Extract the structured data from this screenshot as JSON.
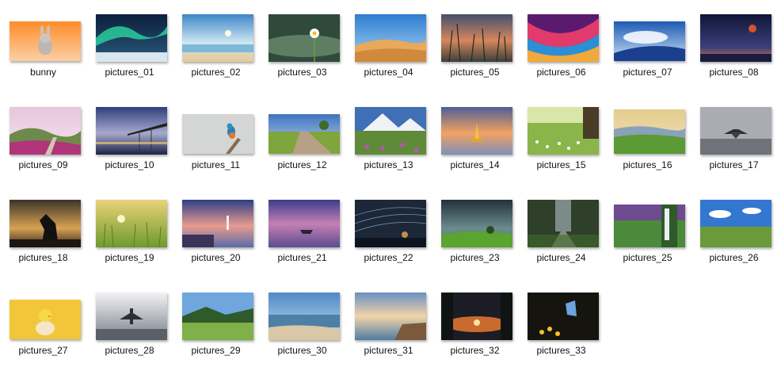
{
  "files": [
    {
      "name": "bunny",
      "icon": "bunny-image"
    },
    {
      "name": "pictures_01",
      "icon": "aurora-image"
    },
    {
      "name": "pictures_02",
      "icon": "seascape-image"
    },
    {
      "name": "pictures_03",
      "icon": "daisy-image"
    },
    {
      "name": "pictures_04",
      "icon": "desert-image"
    },
    {
      "name": "pictures_05",
      "icon": "grass-sunset-image"
    },
    {
      "name": "pictures_06",
      "icon": "abstract-waves-image"
    },
    {
      "name": "pictures_07",
      "icon": "sky-wave-image"
    },
    {
      "name": "pictures_08",
      "icon": "balloon-night-image"
    },
    {
      "name": "pictures_09",
      "icon": "flower-hills-image"
    },
    {
      "name": "pictures_10",
      "icon": "bridge-image"
    },
    {
      "name": "pictures_11",
      "icon": "kingfisher-image"
    },
    {
      "name": "pictures_12",
      "icon": "country-road-image"
    },
    {
      "name": "pictures_13",
      "icon": "mountain-flowers-image"
    },
    {
      "name": "pictures_14",
      "icon": "temple-dusk-image"
    },
    {
      "name": "pictures_15",
      "icon": "meadow-image"
    },
    {
      "name": "pictures_16",
      "icon": "green-valley-image"
    },
    {
      "name": "pictures_17",
      "icon": "jet-image"
    },
    {
      "name": "pictures_18",
      "icon": "horse-silhouette-image"
    },
    {
      "name": "pictures_19",
      "icon": "wheat-field-image"
    },
    {
      "name": "pictures_20",
      "icon": "lighthouse-image"
    },
    {
      "name": "pictures_21",
      "icon": "boat-lake-image"
    },
    {
      "name": "pictures_22",
      "icon": "star-trails-image"
    },
    {
      "name": "pictures_23",
      "icon": "storm-tree-image"
    },
    {
      "name": "pictures_24",
      "icon": "forest-path-image"
    },
    {
      "name": "pictures_25",
      "icon": "waterfall-image"
    },
    {
      "name": "pictures_26",
      "icon": "green-plain-image"
    },
    {
      "name": "pictures_27",
      "icon": "chick-image"
    },
    {
      "name": "pictures_28",
      "icon": "fighter-jet-image"
    },
    {
      "name": "pictures_29",
      "icon": "alpine-meadow-image"
    },
    {
      "name": "pictures_30",
      "icon": "beach-image"
    },
    {
      "name": "pictures_31",
      "icon": "coast-town-image"
    },
    {
      "name": "pictures_32",
      "icon": "lake-sunset-image"
    },
    {
      "name": "pictures_33",
      "icon": "butterfly-image"
    }
  ]
}
